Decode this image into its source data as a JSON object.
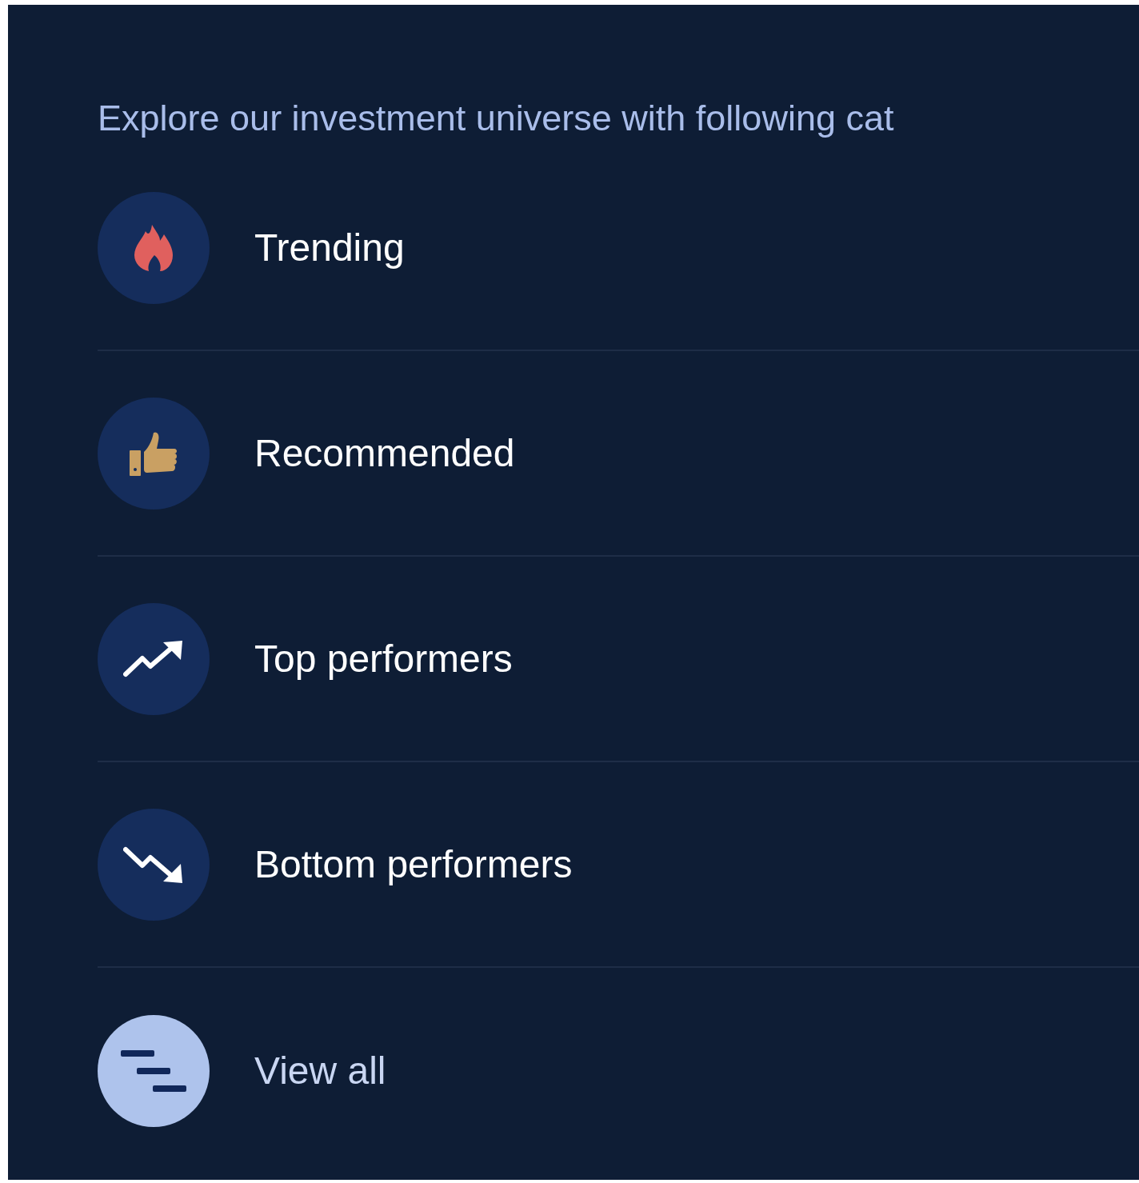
{
  "heading": "Explore our investment universe with following cat",
  "categories": [
    {
      "label": "Trending",
      "kind": "flame"
    },
    {
      "label": "Recommended",
      "kind": "thumbs-up"
    },
    {
      "label": "Top performers",
      "kind": "trend-up"
    },
    {
      "label": "Bottom performers",
      "kind": "trend-down"
    },
    {
      "label": "View all",
      "kind": "list"
    }
  ]
}
